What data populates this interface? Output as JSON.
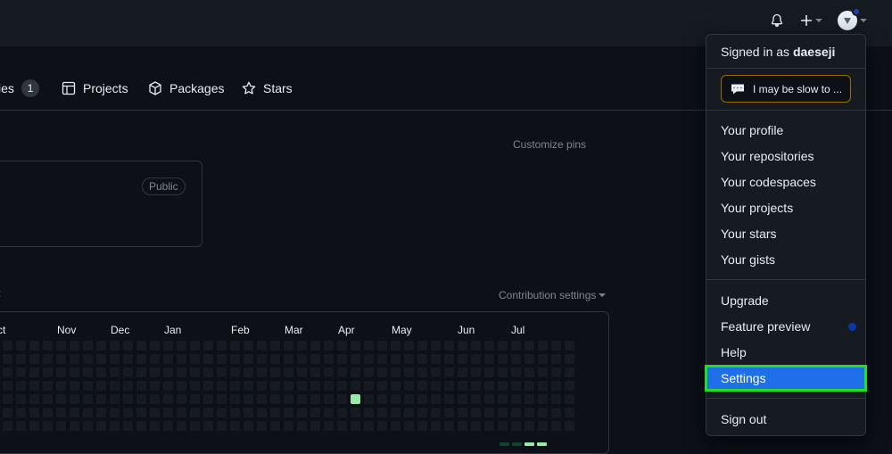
{
  "header": {
    "icons": [
      "bell-icon",
      "plus-icon",
      "avatar"
    ]
  },
  "nav": {
    "repositories_label": "ies",
    "repositories_count": "1",
    "projects_label": "Projects",
    "packages_label": "Packages",
    "stars_label": "Stars"
  },
  "pinned": {
    "customize_label": "Customize pins",
    "badge": "Public"
  },
  "contributions": {
    "settings_label": "Contribution settings",
    "months": [
      "ct",
      "Nov",
      "Dec",
      "Jan",
      "Feb",
      "Mar",
      "Apr",
      "May",
      "Jun",
      "Jul"
    ],
    "colors": {
      "empty": "#161b22",
      "level1": "#0e4429",
      "level3": "#26a641",
      "level4": "#9be9a8"
    }
  },
  "dropdown": {
    "signed_in_prefix": "Signed in as",
    "username": "daeseji",
    "status_text": "I may be slow to ...",
    "items_group1": [
      "Your profile",
      "Your repositories",
      "Your codespaces",
      "Your projects",
      "Your stars",
      "Your gists"
    ],
    "upgrade": "Upgrade",
    "feature_preview": "Feature preview",
    "help": "Help",
    "settings": "Settings",
    "sign_out": "Sign out",
    "accent_color": "#1f6feb",
    "highlight_color": "#22e01f"
  }
}
